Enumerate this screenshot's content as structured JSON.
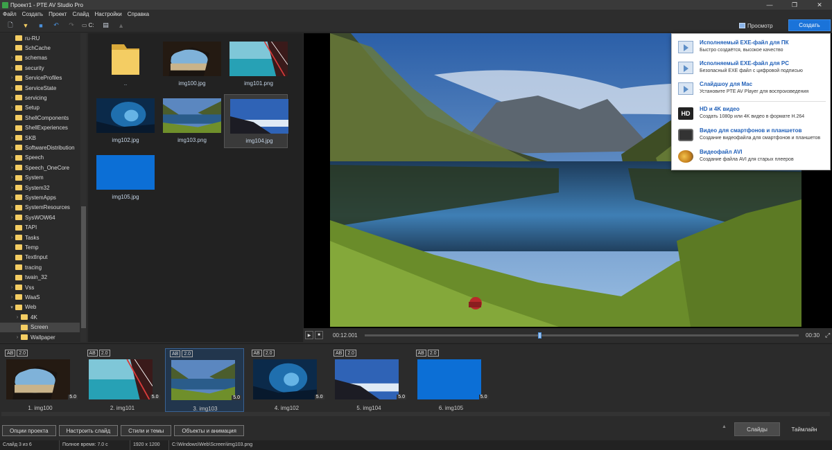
{
  "window": {
    "title": "Проект1 - PTE AV Studio Pro",
    "controls": [
      "—",
      "❐",
      "✕"
    ]
  },
  "menu": [
    "Файл",
    "Создать",
    "Проект",
    "Слайд",
    "Настройки",
    "Справка"
  ],
  "toolbar": {
    "drive_label": "C:",
    "preview_label": "Просмотр",
    "create_label": "Создать"
  },
  "tree": {
    "items": [
      {
        "label": "ru-RU",
        "expandable": false
      },
      {
        "label": "SchCache",
        "expandable": false
      },
      {
        "label": "schemas",
        "expandable": true
      },
      {
        "label": "security",
        "expandable": true
      },
      {
        "label": "ServiceProfiles",
        "expandable": true
      },
      {
        "label": "ServiceState",
        "expandable": true
      },
      {
        "label": "servicing",
        "expandable": true
      },
      {
        "label": "Setup",
        "expandable": true
      },
      {
        "label": "ShellComponents",
        "expandable": false
      },
      {
        "label": "ShellExperiences",
        "expandable": false
      },
      {
        "label": "SKB",
        "expandable": true
      },
      {
        "label": "SoftwareDistribution",
        "expandable": true
      },
      {
        "label": "Speech",
        "expandable": true
      },
      {
        "label": "Speech_OneCore",
        "expandable": true
      },
      {
        "label": "System",
        "expandable": true
      },
      {
        "label": "System32",
        "expandable": true
      },
      {
        "label": "SystemApps",
        "expandable": true
      },
      {
        "label": "SystemResources",
        "expandable": true
      },
      {
        "label": "SysWOW64",
        "expandable": true
      },
      {
        "label": "TAPI",
        "expandable": false
      },
      {
        "label": "Tasks",
        "expandable": true
      },
      {
        "label": "Temp",
        "expandable": false
      },
      {
        "label": "TextInput",
        "expandable": false
      },
      {
        "label": "tracing",
        "expandable": false
      },
      {
        "label": "twain_32",
        "expandable": false
      },
      {
        "label": "Vss",
        "expandable": true
      },
      {
        "label": "WaaS",
        "expandable": true
      },
      {
        "label": "Web",
        "expandable": true,
        "expanded": true
      },
      {
        "label": "4K",
        "expandable": true,
        "indent": 1
      },
      {
        "label": "Screen",
        "expandable": false,
        "indent": 1,
        "selected": true
      },
      {
        "label": "Wallpaper",
        "expandable": true,
        "indent": 1
      }
    ]
  },
  "files": [
    {
      "name": "..",
      "kind": "folder"
    },
    {
      "name": "img100.jpg",
      "kind": "cave"
    },
    {
      "name": "img101.png",
      "kind": "sea"
    },
    {
      "name": "img102.jpg",
      "kind": "underwater"
    },
    {
      "name": "img103.png",
      "kind": "lake"
    },
    {
      "name": "img104.jpg",
      "kind": "sky",
      "selected": true
    },
    {
      "name": "img105.jpg",
      "kind": "blue"
    }
  ],
  "player": {
    "current_time": "00:12.001",
    "end_time": "00:30",
    "progress_fraction": 0.4
  },
  "create_menu": [
    {
      "title": "Исполняемый EXE-файл для ПК",
      "subtitle": "Быстро создаётся, высокое качество",
      "icon": "screen-play-icon"
    },
    {
      "title": "Исполняемый EXE-файл для PC",
      "subtitle": "Безопасный EXE файл с цифровой подписью",
      "icon": "screen-play-icon"
    },
    {
      "title": "Слайдшоу для Mac",
      "subtitle": "Установите PTE AV Player для воспроизведения",
      "icon": "screen-play-icon"
    },
    {
      "title": "HD и 4K видео",
      "subtitle": "Создать 1080p или 4K видео в формате H.264",
      "icon": "hd-icon"
    },
    {
      "title": "Видео для смартфонов и планшетов",
      "subtitle": "Создание видеофайла для смартфонов и планшетов",
      "icon": "tablet-icon"
    },
    {
      "title": "Видеофайл AVI",
      "subtitle": "Создание файла AVI для старых плееров",
      "icon": "avi-icon"
    }
  ],
  "hd_icon_text": "HD",
  "slides": [
    {
      "name": "1. img100",
      "duration": "5.0",
      "badge_ab": "AB",
      "badge_tr": "2.0",
      "kind": "cave"
    },
    {
      "name": "2. img101",
      "duration": "5.0",
      "badge_ab": "AB",
      "badge_tr": "2.0",
      "kind": "sea"
    },
    {
      "name": "3. img103",
      "duration": "5.0",
      "badge_ab": "AB",
      "badge_tr": "2.0",
      "kind": "lake",
      "selected": true
    },
    {
      "name": "4. img102",
      "duration": "5.0",
      "badge_ab": "AB",
      "badge_tr": "2.0",
      "kind": "underwater"
    },
    {
      "name": "5. img104",
      "duration": "5.0",
      "badge_ab": "AB",
      "badge_tr": "2.0",
      "kind": "sky"
    },
    {
      "name": "6. img105",
      "duration": "5.0",
      "badge_ab": "AB",
      "badge_tr": "2.0",
      "kind": "blue"
    }
  ],
  "bottom_buttons": [
    "Опции проекта",
    "Настроить слайд",
    "Стили и темы",
    "Объекты и анимация"
  ],
  "view_tabs": {
    "slides": "Слайды",
    "timeline": "Таймлайн"
  },
  "status": {
    "slide_pos": "Слайд 3 из 6",
    "total_time": "Полное время: 7.0 с",
    "resolution": "1920 x 1200",
    "path": "C:\\Windows\\Web\\Screen\\img103.png"
  },
  "colors": {
    "accent": "#1a73d9",
    "menu_title": "#1f5fb8",
    "folder": "#f4cd63"
  }
}
